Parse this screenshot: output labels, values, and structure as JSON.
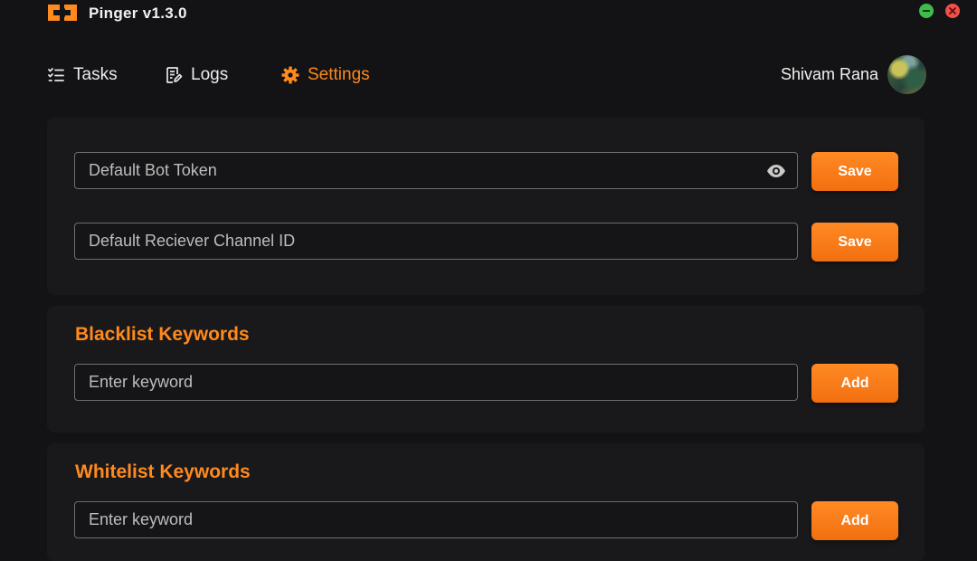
{
  "app": {
    "title": "Pinger v1.3.0"
  },
  "nav": {
    "tasks": "Tasks",
    "logs": "Logs",
    "settings": "Settings"
  },
  "user": {
    "name": "Shivam Rana"
  },
  "settings": {
    "bot_token": {
      "placeholder": "Default Bot Token",
      "value": "",
      "button": "Save"
    },
    "channel_id": {
      "placeholder": "Default Reciever Channel ID",
      "value": "",
      "button": "Save"
    }
  },
  "blacklist": {
    "title": "Blacklist Keywords",
    "placeholder": "Enter keyword",
    "button": "Add"
  },
  "whitelist": {
    "title": "Whitelist Keywords",
    "placeholder": "Enter keyword",
    "button": "Add"
  },
  "theme": {
    "accent": "#ff8a1d",
    "background": "#131214",
    "panel": "#19181b"
  },
  "icons": {
    "logo": "pinger-logo-icon",
    "tasks": "checklist-icon",
    "logs": "edit-document-icon",
    "settings": "gear-icon",
    "eye": "eye-icon",
    "minimize": "minimize-icon",
    "close": "close-icon"
  }
}
